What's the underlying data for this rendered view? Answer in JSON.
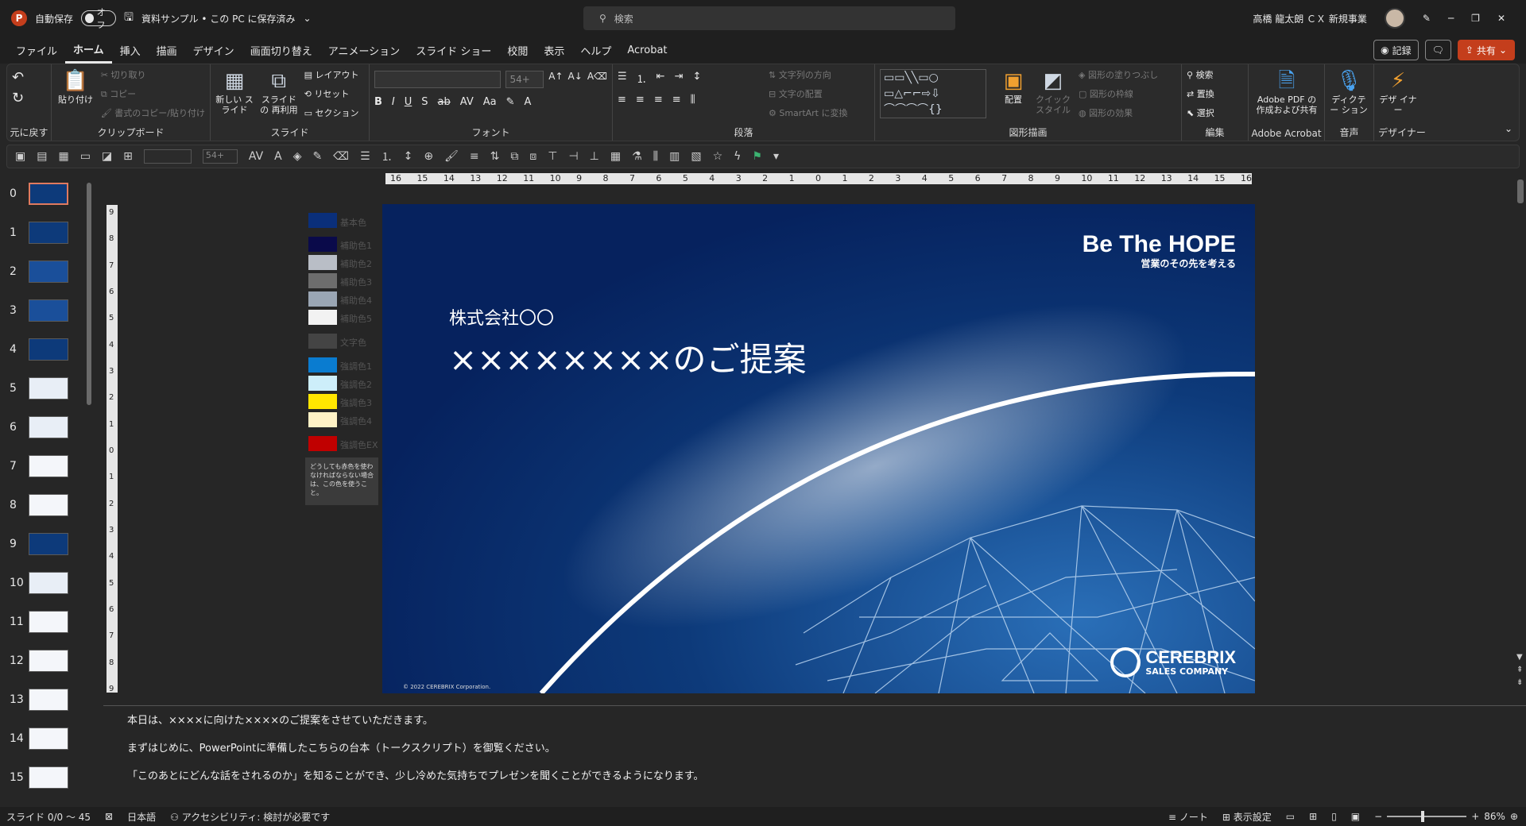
{
  "titlebar": {
    "app_letter": "P",
    "autosave_label": "自動保存",
    "toggle_label": "オフ",
    "doc_title": "資料サンプル • この PC に保存済み",
    "search_placeholder": "検索",
    "user_name": "高橋 龍太朗 ＣＸ 新規事業"
  },
  "menu": {
    "items": [
      "ファイル",
      "ホーム",
      "挿入",
      "描画",
      "デザイン",
      "画面切り替え",
      "アニメーション",
      "スライド ショー",
      "校閲",
      "表示",
      "ヘルプ",
      "Acrobat"
    ],
    "record_label": "記録",
    "share_label": "共有"
  },
  "ribbon": {
    "undo": {
      "label": "元に戻す"
    },
    "clipboard": {
      "paste": "貼り付け",
      "cut": "切り取り",
      "copy": "コピー",
      "format_painter": "書式のコピー/貼り付け",
      "label": "クリップボード"
    },
    "slides": {
      "new_slide": "新しい スライド",
      "reuse": "スライドの 再利用",
      "layout": "レイアウト",
      "reset": "リセット",
      "section": "セクション",
      "label": "スライド"
    },
    "font": {
      "size": "54+",
      "label": "フォント"
    },
    "paragraph": {
      "text_direction": "文字列の方向",
      "align_text": "文字の配置",
      "smartart": "SmartArt に変換",
      "label": "段落"
    },
    "drawing": {
      "arrange": "配置",
      "quick_styles": "クイック スタイル",
      "fill": "図形の塗りつぶし",
      "outline": "図形の枠線",
      "effects": "図形の効果",
      "label": "図形描画"
    },
    "editing": {
      "find": "検索",
      "replace": "置換",
      "select": "選択",
      "label": "編集"
    },
    "acrobat": {
      "create": "Adobe PDF の 作成および共有",
      "label": "Adobe Acrobat"
    },
    "voice": {
      "dictate": "ディクテー ション",
      "label": "音声"
    },
    "designer": {
      "designer": "デザ イナー",
      "label": "デザイナー"
    }
  },
  "qbar": {
    "font_size": "54+"
  },
  "thumbnails": [
    {
      "num": "0"
    },
    {
      "num": "1"
    },
    {
      "num": "2"
    },
    {
      "num": "3"
    },
    {
      "num": "4"
    },
    {
      "num": "5"
    },
    {
      "num": "6"
    },
    {
      "num": "7"
    },
    {
      "num": "8"
    },
    {
      "num": "9"
    },
    {
      "num": "10"
    },
    {
      "num": "11"
    },
    {
      "num": "12"
    },
    {
      "num": "13"
    },
    {
      "num": "14"
    },
    {
      "num": "15"
    }
  ],
  "ruler": {
    "h_ticks": [
      "16",
      "15",
      "14",
      "13",
      "12",
      "11",
      "10",
      "9",
      "8",
      "7",
      "6",
      "5",
      "4",
      "3",
      "2",
      "1",
      "0",
      "1",
      "2",
      "3",
      "4",
      "5",
      "6",
      "7",
      "8",
      "9",
      "10",
      "11",
      "12",
      "13",
      "14",
      "15",
      "16"
    ],
    "v_ticks": [
      "9",
      "8",
      "7",
      "6",
      "5",
      "4",
      "3",
      "2",
      "1",
      "0",
      "1",
      "2",
      "3",
      "4",
      "5",
      "6",
      "7",
      "8",
      "9"
    ]
  },
  "swatches": {
    "items": [
      {
        "label": "基本色",
        "color": "#0a2f7a"
      },
      {
        "label": "補助色1",
        "color": "#0a0a4a"
      },
      {
        "label": "補助色2",
        "color": "#b9bec6"
      },
      {
        "label": "補助色3",
        "color": "#6d6d6d"
      },
      {
        "label": "補助色4",
        "color": "#9aa6b4"
      },
      {
        "label": "補助色5",
        "color": "#f2f2f2"
      },
      {
        "label": "文字色",
        "color": "#444444"
      },
      {
        "label": "強調色1",
        "color": "#0a7cd0"
      },
      {
        "label": "強調色2",
        "color": "#cdeefa"
      },
      {
        "label": "強調色3",
        "color": "#ffe600"
      },
      {
        "label": "強調色4",
        "color": "#fff2c6"
      },
      {
        "label": "強調色EX",
        "color": "#c00000"
      }
    ],
    "note": "どうしても赤色を使わなければならない場合は、この色を使うこと。"
  },
  "slide": {
    "company": "株式会社〇〇",
    "title": "××××××××のご提案",
    "logo_line1": "Be The HOPE",
    "logo_line2": "営業のその先を考える",
    "brand_line1": "CEREBRIX",
    "brand_line2": "SALES COMPANY",
    "copyright": "© 2022 CEREBRIX Corporation."
  },
  "notes": {
    "lines": [
      "本日は、××××に向けた××××のご提案をさせていただきます。",
      "まずはじめに、PowerPointに準備したこちらの台本（トークスクリプト）を御覧ください。",
      "「このあとにどんな話をされるのか」を知ることができ、少し冷めた気持ちでプレゼンを聞くことができるようになります。"
    ]
  },
  "status": {
    "slide_info": "スライド 0/0 ～ 45",
    "language": "日本語",
    "accessibility": "アクセシビリティ: 検討が必要です",
    "notes_btn": "ノート",
    "display_settings": "表示設定",
    "zoom": "86%",
    "zoom_fraction": 0.43
  }
}
